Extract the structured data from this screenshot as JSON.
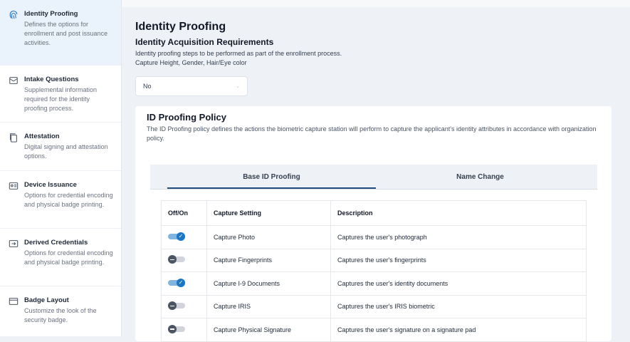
{
  "sidebar": {
    "items": [
      {
        "title": "Identity Proofing",
        "desc": "Defines the options for enrollment and post issuance activities.",
        "icon": "fingerprint-icon"
      },
      {
        "title": "Intake Questions",
        "desc": "Supplemental information required for the identity proofing process.",
        "icon": "envelope-icon"
      },
      {
        "title": "Attestation",
        "desc": "Digital signing and attestation options.",
        "icon": "document-copy-icon"
      },
      {
        "title": "Device Issuance",
        "desc": "Options for credential encoding and physical badge printing.",
        "icon": "id-card-icon"
      },
      {
        "title": "Derived Credentials",
        "desc": "Options for credential encoding and physical badge printing.",
        "icon": "card-arrow-icon"
      },
      {
        "title": "Badge Layout",
        "desc": "Customize the look of the security badge.",
        "icon": "badge-layout-icon"
      }
    ]
  },
  "main": {
    "title": "Identity Proofing",
    "section_title": "Identity Acquisition Requirements",
    "section_desc1": "Identity proofing steps to be performed as part of the enrollment process.",
    "section_desc2": "Capture Height, Gender, Hair/Eye color",
    "select_value": "No"
  },
  "policy": {
    "title": "ID Proofing Policy",
    "desc": "The ID Proofing policy defines the actions the biometric capture station will perform to capture the applicant's identity attributes in accordance with organization policy.",
    "tabs": [
      "Base ID Proofing",
      "Name Change"
    ],
    "columns": [
      "Off/On",
      "Capture Setting",
      "Description"
    ],
    "rows": [
      {
        "on": true,
        "setting": "Capture Photo",
        "desc": "Captures the user's photograph"
      },
      {
        "on": false,
        "setting": "Capture Fingerprints",
        "desc": "Captures the user's fingerprints"
      },
      {
        "on": true,
        "setting": "Capture I-9 Documents",
        "desc": "Captures the user's identity documents"
      },
      {
        "on": false,
        "setting": "Capture IRIS",
        "desc": "Captures the user's IRIS biometric"
      },
      {
        "on": false,
        "setting": "Capture Physical Signature",
        "desc": "Captures the user's signature on a signature pad"
      }
    ]
  },
  "colors": {
    "accent": "#1976c9",
    "active_tab_underline": "#1f4e79",
    "active_sidebar_bg": "#eaf2fb"
  }
}
